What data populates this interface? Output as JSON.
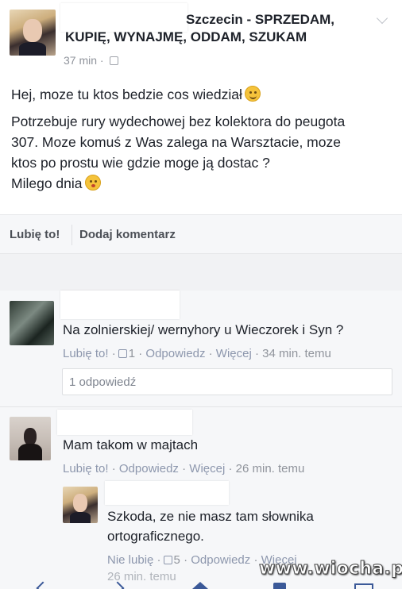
{
  "post": {
    "group_title_line1": "Szczecin - SPRZEDAM,",
    "group_title_line2": "KUPIĘ, WYNAJMĘ, ODDAM, SZUKAM",
    "time": "37 min",
    "time_separator": "·",
    "body_line1": "Hej, moze tu ktos bedzie cos wiedział",
    "body_line2": "Potrzebuje rury wydechowej bez kolektora do peugota",
    "body_line3": "307. Moze komuś z Was zalega na Warsztacie, moze",
    "body_line4": "ktos po prostu wie gdzie moge ją dostac ?",
    "body_line5": "Milego dnia",
    "icons": {
      "menu": "chevron-down-icon",
      "privacy": "group-icon",
      "smile": "smile-emoji",
      "kiss": "kiss-emoji"
    }
  },
  "actions": {
    "like_label": "Lubię to!",
    "comment_label": "Dodaj komentarz"
  },
  "comments": [
    {
      "text": "Na zolnierskiej/ wernyhory u Wieczorek i Syn ?",
      "like": "Lubię to!",
      "like_count": "1",
      "reply": "Odpowiedz",
      "more": "Więcej",
      "time": "34 min. temu",
      "replies_label": "1 odpowiedź"
    },
    {
      "text": "Mam takom w majtach",
      "like": "Lubię to!",
      "reply": "Odpowiedz",
      "more": "Więcej",
      "time": "26 min. temu"
    }
  ],
  "reply": {
    "text_line1": "Szkoda, ze nie masz tam słownika",
    "text_line2": "ortograficznego.",
    "like": "Nie lubię",
    "like_count": "5",
    "reply": "Odpowiedz",
    "more": "Więcej",
    "time": "26 min. temu"
  },
  "separator": "·",
  "watermark": "www.wiocha.pl",
  "colors": {
    "link": "#8d97ad",
    "meta": "#90949c",
    "text": "#1d2129",
    "brand": "#3b5998"
  }
}
